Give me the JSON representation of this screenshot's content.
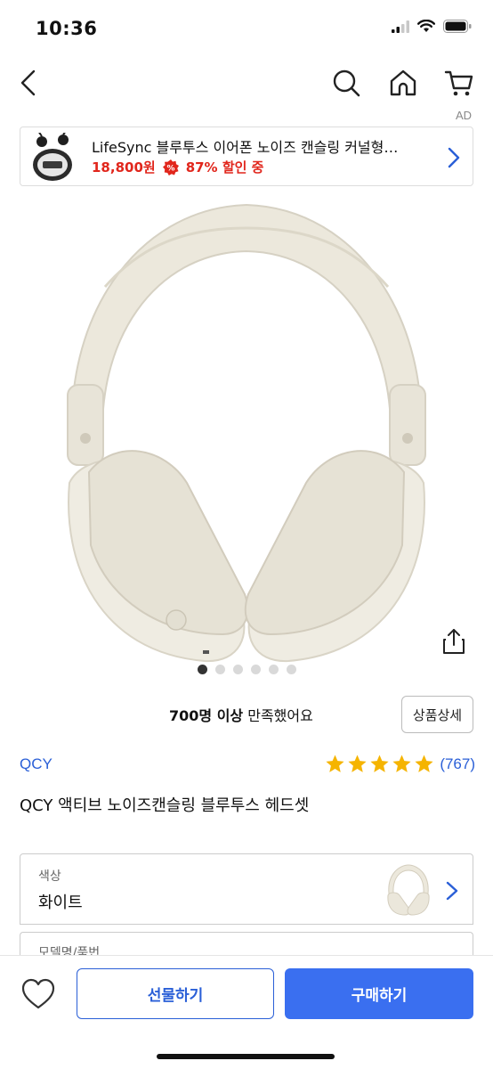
{
  "status_bar": {
    "time": "10:36"
  },
  "nav": {
    "ad_label": "AD"
  },
  "ad": {
    "title": "LifeSync 블루투스 이어폰 노이즈 캔슬링 커널형…",
    "price": "18,800원",
    "discount": "87% 할인 중",
    "price_color": "#e1261c"
  },
  "gallery": {
    "page_count": 6,
    "active_page": 1
  },
  "satisfaction": {
    "count": "700명 이상",
    "text": " 만족했어요"
  },
  "detail_button": "상품상세",
  "product": {
    "brand": "QCY",
    "rating_count": "(767)",
    "stars": 5,
    "title": "QCY 액티브 노이즈캔슬링 블루투스 헤드셋"
  },
  "options": [
    {
      "label": "색상",
      "value": "화이트"
    },
    {
      "label": "모델명/품번"
    }
  ],
  "bottom_bar": {
    "gift_label": "선물하기",
    "buy_label": "구매하기",
    "accent_color": "#3a6ff0"
  },
  "icons": [
    "back-icon",
    "search-icon",
    "home-icon",
    "cart-icon",
    "chevron-right-icon",
    "share-icon",
    "star-icon",
    "heart-icon"
  ]
}
